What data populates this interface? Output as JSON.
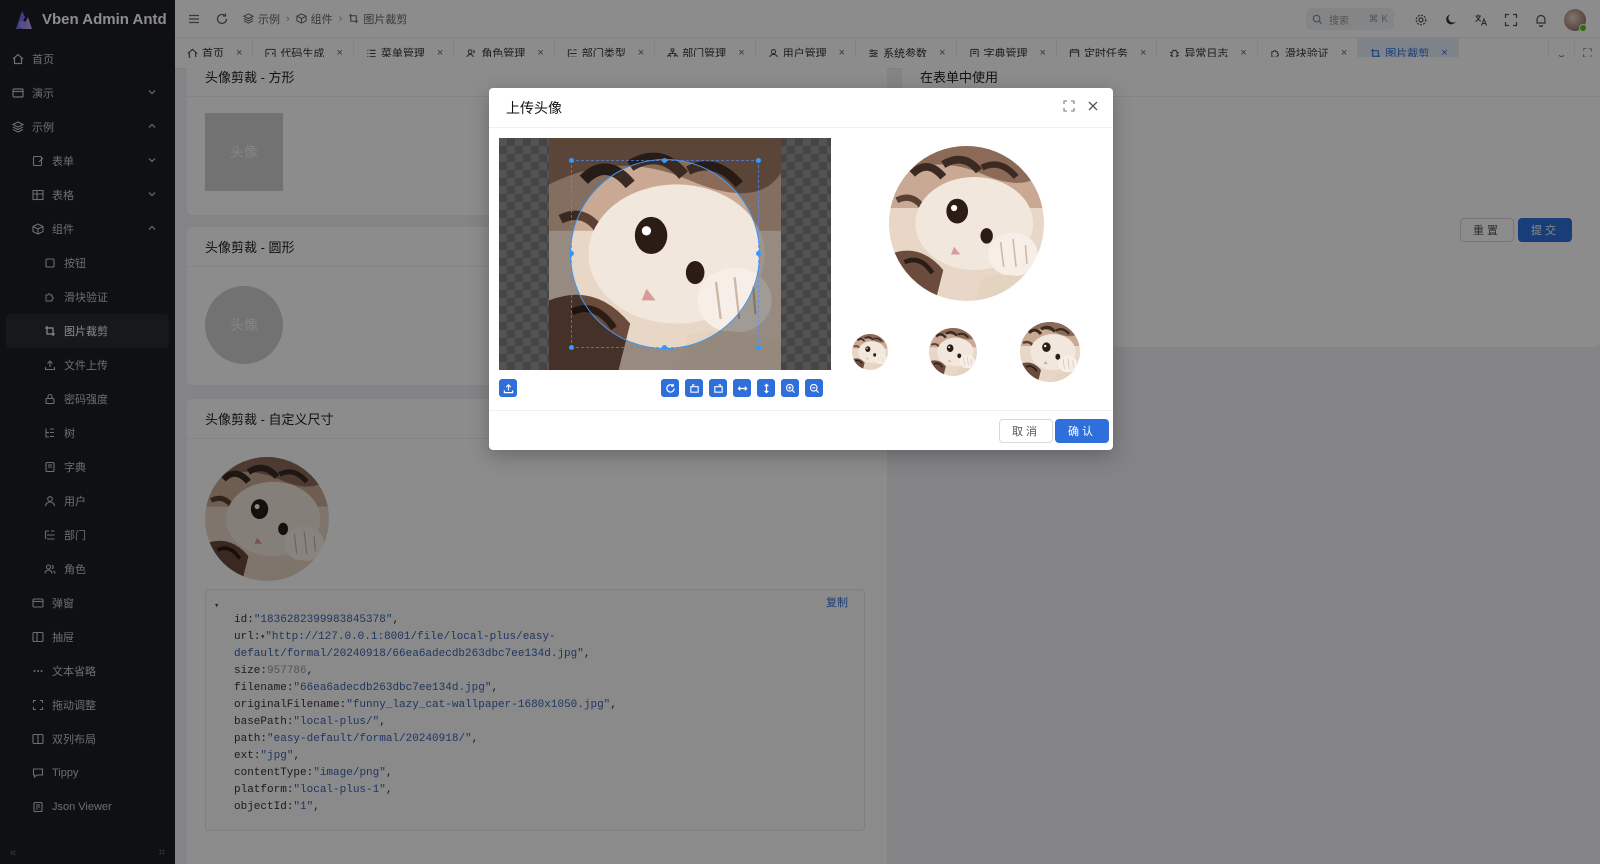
{
  "app": {
    "title": "Vben Admin Antd"
  },
  "sidebar": {
    "items": [
      {
        "label": "首页",
        "icon": "home-icon"
      },
      {
        "label": "演示",
        "icon": "window-icon"
      },
      {
        "label": "示例",
        "icon": "layers-icon"
      },
      {
        "label": "表单",
        "icon": "form-icon"
      },
      {
        "label": "表格",
        "icon": "table-icon"
      },
      {
        "label": "组件",
        "icon": "cube-icon"
      },
      {
        "label": "按钮",
        "icon": "square-icon"
      },
      {
        "label": "滑块验证",
        "icon": "puzzle-icon"
      },
      {
        "label": "图片裁剪",
        "icon": "crop-icon"
      },
      {
        "label": "文件上传",
        "icon": "upload-icon"
      },
      {
        "label": "密码强度",
        "icon": "lock-icon"
      },
      {
        "label": "树",
        "icon": "tree-icon"
      },
      {
        "label": "字典",
        "icon": "book-icon"
      },
      {
        "label": "用户",
        "icon": "user-icon"
      },
      {
        "label": "部门",
        "icon": "dept-icon"
      },
      {
        "label": "角色",
        "icon": "role-icon"
      },
      {
        "label": "弹窗",
        "icon": "modal-icon"
      },
      {
        "label": "抽屉",
        "icon": "drawer-icon"
      },
      {
        "label": "文本省略",
        "icon": "ellipsis-icon"
      },
      {
        "label": "拖动调整",
        "icon": "resize-icon"
      },
      {
        "label": "双列布局",
        "icon": "columns-icon"
      },
      {
        "label": "Tippy",
        "icon": "tooltip-icon"
      },
      {
        "label": "Json Viewer",
        "icon": "json-icon"
      }
    ]
  },
  "breadcrumb": [
    {
      "label": "示例"
    },
    {
      "label": "组件"
    },
    {
      "label": "图片裁剪"
    }
  ],
  "header": {
    "search_placeholder": "搜索",
    "search_shortcut": "⌘ K"
  },
  "tabs": [
    {
      "label": "首页",
      "icon": "home-icon"
    },
    {
      "label": "代码生成",
      "icon": "code-icon"
    },
    {
      "label": "菜单管理",
      "icon": "list-icon"
    },
    {
      "label": "角色管理",
      "icon": "role-icon"
    },
    {
      "label": "部门类型",
      "icon": "dept-icon"
    },
    {
      "label": "部门管理",
      "icon": "org-icon"
    },
    {
      "label": "用户管理",
      "icon": "user-icon"
    },
    {
      "label": "系统参数",
      "icon": "settings-icon"
    },
    {
      "label": "字典管理",
      "icon": "book-icon"
    },
    {
      "label": "定时任务",
      "icon": "calendar-icon"
    },
    {
      "label": "异常日志",
      "icon": "bug-icon"
    },
    {
      "label": "滑块验证",
      "icon": "puzzle-icon"
    },
    {
      "label": "图片裁剪",
      "icon": "crop-icon"
    }
  ],
  "main": {
    "card1_title": "头像剪裁 - 方形",
    "card2_title": "头像剪裁 - 圆形",
    "card3_title": "头像剪裁 - 自定义尺寸",
    "card4_title": "在表单中使用",
    "placeholder": "头像",
    "copy_label": "复制",
    "reset_label": "重置",
    "submit_label": "提交",
    "json": [
      {
        "key": "id",
        "value": "\"1836282399983845378\"",
        "type": "s"
      },
      {
        "key": "url",
        "value": "\"http://127.0.0.1:8001/file/local-plus/easy-",
        "type": "s",
        "toggle": "▾"
      },
      {
        "key": "",
        "value": "default/formal/20240918/66ea6adecdb263dbc7ee134d.jpg\"",
        "type": "s"
      },
      {
        "key": "size",
        "value": "957786",
        "type": "n"
      },
      {
        "key": "filename",
        "value": "\"66ea6adecdb263dbc7ee134d.jpg\"",
        "type": "s"
      },
      {
        "key": "originalFilename",
        "value": "\"funny_lazy_cat-wallpaper-1680x1050.jpg\"",
        "type": "s"
      },
      {
        "key": "basePath",
        "value": "\"local-plus/\"",
        "type": "s"
      },
      {
        "key": "path",
        "value": "\"easy-default/formal/20240918/\"",
        "type": "s"
      },
      {
        "key": "ext",
        "value": "\"jpg\"",
        "type": "s"
      },
      {
        "key": "contentType",
        "value": "\"image/png\"",
        "type": "s"
      },
      {
        "key": "platform",
        "value": "\"local-plus-1\"",
        "type": "s"
      },
      {
        "key": "objectId",
        "value": "\"1\"",
        "type": "s"
      }
    ]
  },
  "modal": {
    "title": "上传头像",
    "cancel_label": "取消",
    "confirm_label": "确认"
  },
  "colors": {
    "accent": "#2f6fdb",
    "sidebar_bg": "#1d1e24"
  }
}
